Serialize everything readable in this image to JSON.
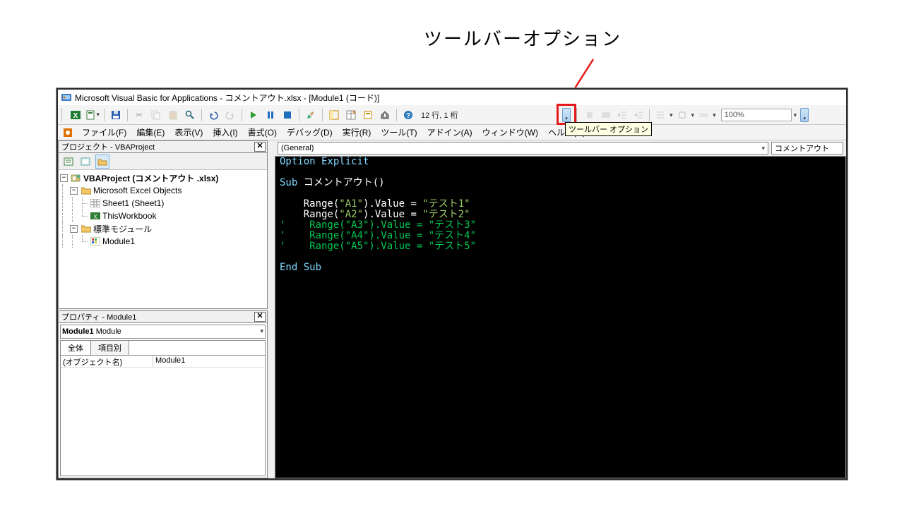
{
  "annotation_label": "ツールバーオプション",
  "window_title": "Microsoft Visual Basic for Applications - コメントアウト.xlsx - [Module1 (コード)]",
  "toolbar": {
    "cursor_text": "12 行, 1 桁",
    "zoom": "100%"
  },
  "tooltip_text": "ツールバー オプション",
  "menus": {
    "app": "ファイル(F)",
    "edit": "編集(E)",
    "view": "表示(V)",
    "insert": "挿入(I)",
    "format": "書式(O)",
    "debug": "デバッグ(D)",
    "run": "実行(R)",
    "tools": "ツール(T)",
    "addins": "アドイン(A)",
    "window": "ウィンドウ(W)",
    "help": "ヘルプ(H)"
  },
  "project_panel": {
    "title": "プロジェクト - VBAProject",
    "root": "VBAProject (コメントアウト .xlsx)",
    "excel_objects": "Microsoft Excel Objects",
    "sheet1": "Sheet1 (Sheet1)",
    "thisworkbook": "ThisWorkbook",
    "std_modules": "標準モジュール",
    "module1": "Module1"
  },
  "properties_panel": {
    "title": "プロパティ - Module1",
    "combo_bold": "Module1",
    "combo_type": "Module",
    "tab_all": "全体",
    "tab_cat": "項目別",
    "row1_key": "(オブジェクト名)",
    "row1_val": "Module1"
  },
  "code_combos": {
    "object": "(General)",
    "procedure": "コメントアウト"
  },
  "code": {
    "l1": "Option Explicit",
    "l2a": "Sub ",
    "l2b": "コメントアウト()",
    "l3a": "    Range(",
    "l3b": "\"A1\"",
    "l3c": ").Value = ",
    "l3d": "\"テスト1\"",
    "l4a": "    Range(",
    "l4b": "\"A2\"",
    "l4c": ").Value = ",
    "l4d": "\"テスト2\"",
    "l5": "'    Range(\"A3\").Value = \"テスト3\"",
    "l6": "'    Range(\"A4\").Value = \"テスト4\"",
    "l7": "'    Range(\"A5\").Value = \"テスト5\"",
    "l8": "End Sub"
  }
}
